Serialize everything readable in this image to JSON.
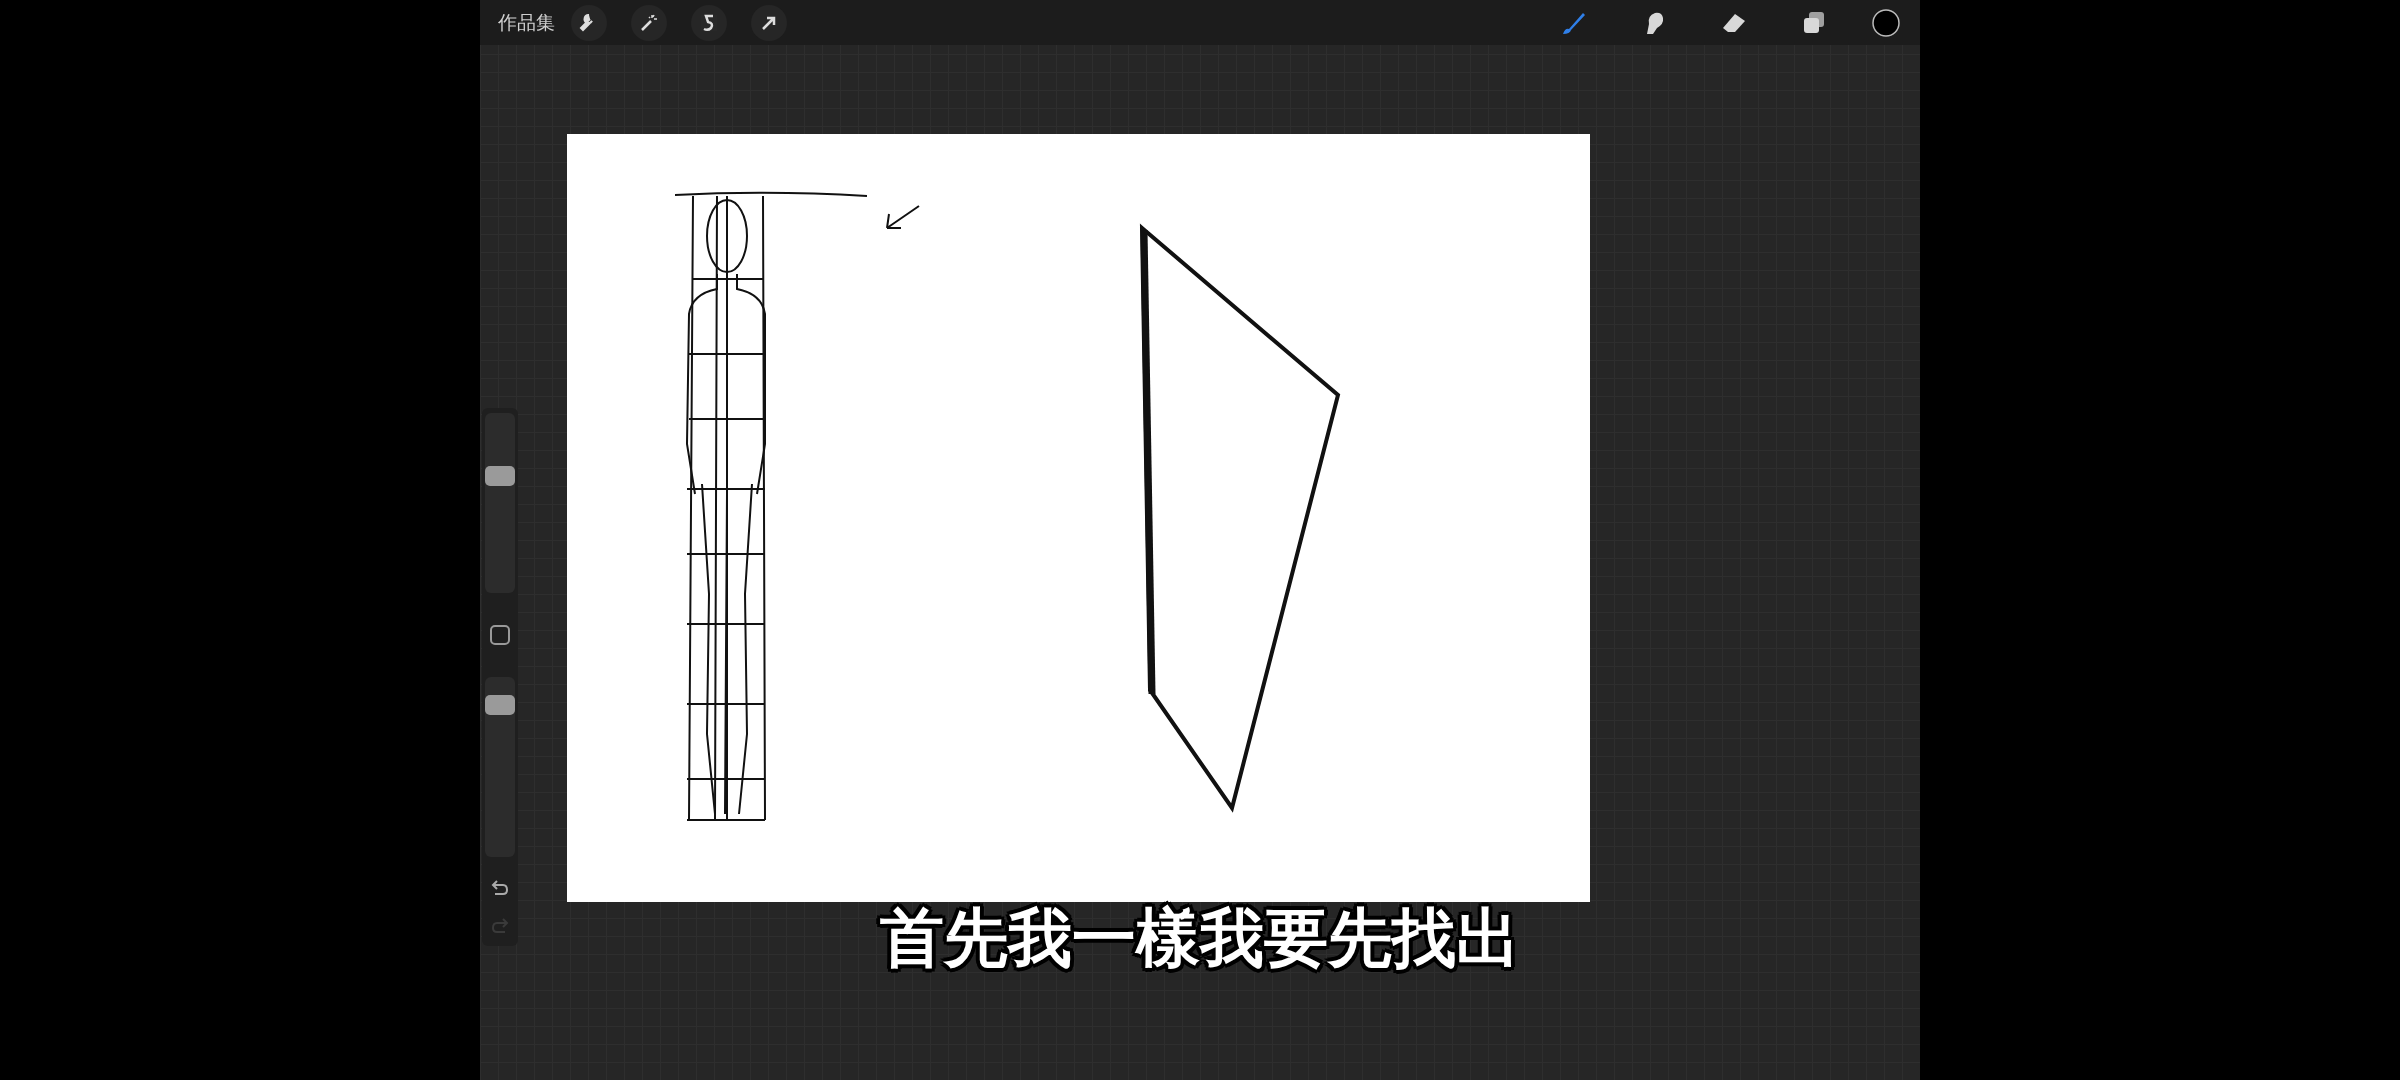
{
  "top_bar": {
    "gallery_label": "作品集",
    "left_tools": [
      {
        "kind": "wrench"
      },
      {
        "kind": "wand"
      },
      {
        "kind": "selection"
      },
      {
        "kind": "transform"
      }
    ],
    "right_tools": [
      {
        "kind": "brush",
        "selected": true
      },
      {
        "kind": "smudge",
        "selected": false
      },
      {
        "kind": "eraser",
        "selected": false
      },
      {
        "kind": "layers",
        "selected": false
      }
    ],
    "color_swatch": {
      "color": "#000000"
    }
  },
  "sidebar": {
    "size_slider": {
      "level": 0.67
    },
    "opacity_slider": {
      "level": 0.89
    },
    "undo": {
      "disabled": false
    },
    "redo": {
      "disabled": true
    }
  },
  "subtitle": "首先我一樣我要先找出"
}
